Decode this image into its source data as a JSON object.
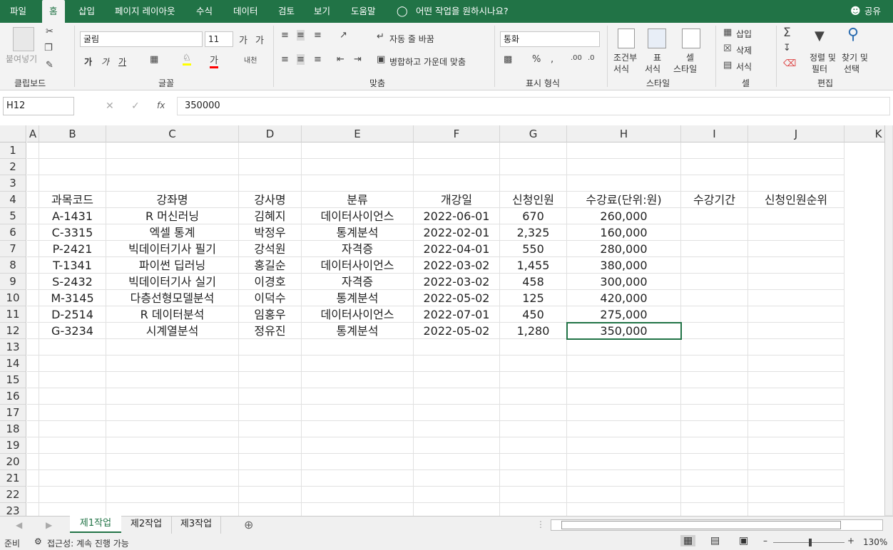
{
  "ribbon_tabs": [
    "파일",
    "홈",
    "삽입",
    "페이지 레이아웃",
    "수식",
    "데이터",
    "검토",
    "보기",
    "도움말"
  ],
  "tell_me": "어떤 작업을 원하시나요?",
  "share": "공유",
  "clipboard": {
    "paste": "붙여넣기",
    "group": "클립보드"
  },
  "font": {
    "name": "굴림",
    "size": "11",
    "group": "글꼴",
    "bold": "가",
    "italic": "가",
    "underline": "가"
  },
  "alignment": {
    "wrap": "자동 줄 바꿈",
    "merge": "병합하고 가운데 맞춤",
    "group": "맞춤"
  },
  "number": {
    "format": "통화",
    "group": "표시 형식"
  },
  "styles": {
    "cond1": "조건부",
    "cond2": "서식",
    "table1": "표",
    "table2": "서식",
    "cell1": "셀",
    "cell2": "스타일",
    "group": "스타일"
  },
  "cells": {
    "insert": "삽입",
    "delete": "삭제",
    "format": "서식",
    "group": "셀"
  },
  "editing": {
    "sort1": "정렬 및",
    "sort2": "필터",
    "find1": "찾기 및",
    "find2": "선택",
    "group": "편집"
  },
  "namebox": "H12",
  "fx": "fx",
  "formula": "350000",
  "columns": [
    "A",
    "B",
    "C",
    "D",
    "E",
    "F",
    "G",
    "H",
    "I",
    "J",
    "K"
  ],
  "rows": [
    "1",
    "2",
    "3",
    "4",
    "5",
    "6",
    "7",
    "8",
    "9",
    "10",
    "11",
    "12",
    "13",
    "14",
    "15",
    "16",
    "17",
    "18",
    "19",
    "20",
    "21",
    "22",
    "23"
  ],
  "headers": [
    "과목코드",
    "강좌명",
    "강사명",
    "분류",
    "개강일",
    "신청인원",
    "수강료(단위:원)",
    "수강기간",
    "신청인원순위"
  ],
  "table": [
    [
      "A-1431",
      "R 머신러닝",
      "김혜지",
      "데이터사이언스",
      "2022-06-01",
      "670",
      "260,000"
    ],
    [
      "C-3315",
      "엑셀 통계",
      "박정우",
      "통계분석",
      "2022-02-01",
      "2,325",
      "160,000"
    ],
    [
      "P-2421",
      "빅데이터기사 필기",
      "강석원",
      "자격증",
      "2022-04-01",
      "550",
      "280,000"
    ],
    [
      "T-1341",
      "파이썬 딥러닝",
      "홍길순",
      "데이터사이언스",
      "2022-03-02",
      "1,455",
      "380,000"
    ],
    [
      "S-2432",
      "빅데이터기사 실기",
      "이경호",
      "자격증",
      "2022-03-02",
      "458",
      "300,000"
    ],
    [
      "M-3145",
      "다층선형모델분석",
      "이덕수",
      "통계분석",
      "2022-05-02",
      "125",
      "420,000"
    ],
    [
      "D-2514",
      "R 데이터분석",
      "임홍우",
      "데이터사이언스",
      "2022-07-01",
      "450",
      "275,000"
    ],
    [
      "G-3234",
      "시계열분석",
      "정유진",
      "통계분석",
      "2022-05-02",
      "1,280",
      "350,000"
    ]
  ],
  "sheets": [
    "제1작업",
    "제2작업",
    "제3작업"
  ],
  "status": {
    "ready": "준비",
    "accessibility": "접근성: 계속 진행 가능",
    "zoom": "130%"
  }
}
